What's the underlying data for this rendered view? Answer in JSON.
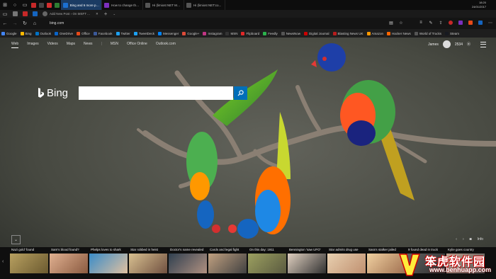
{
  "system": {
    "time": "18:20",
    "date": "24/01/2017"
  },
  "tabs": [
    {
      "title": "Bing and 6 more pa...",
      "active": true,
      "icon_color": "#1b6fd1"
    },
    {
      "title": "How to change the...",
      "active": false,
      "icon_color": "#7b2fbe"
    },
    {
      "title": "Hi (limiost NET Ma...",
      "active": false,
      "icon_color": "#555555"
    },
    {
      "title": "Hi (limiost NET:co...",
      "active": false,
      "icon_color": "#555555"
    }
  ],
  "secondary_tab": {
    "title": "Add New Post ‹ On MSFT ..."
  },
  "address": {
    "url": "bing.com"
  },
  "favorites": [
    "Google",
    "Bing",
    "Outlook",
    "OneDrive",
    "Office",
    "Facebook",
    "Twitter",
    "TweetDeck",
    "Messenger",
    "Google+",
    "Instagram",
    "MSN",
    "Flipboard",
    "Feedly",
    "NewsNow",
    "Digital Journal",
    "Blasting News UK",
    "Amazon",
    "Hacker News",
    "World of Trucks",
    "Steam"
  ],
  "bing": {
    "nav": [
      "Web",
      "Images",
      "Videos",
      "Maps",
      "News",
      "MSN",
      "Office Online",
      "Outlook.com"
    ],
    "user_name": "James",
    "rewards_points": "2534",
    "logo_text": "Bing",
    "search_value": "",
    "info_label": "Info"
  },
  "news": [
    {
      "caption": "Nazi gold' found"
    },
    {
      "caption": "Sam's blood found?"
    },
    {
      "caption": "Phelps loves to shark"
    },
    {
      "caption": "Star robbed in heist"
    },
    {
      "caption": "Doctor's name revealed"
    },
    {
      "caption": "Cards and legal fight"
    },
    {
      "caption": "On this day: 1911"
    },
    {
      "caption": "Bennington 'saw UFO'"
    },
    {
      "caption": "Star admits drug use"
    },
    {
      "caption": "Sara's stalker jailed"
    },
    {
      "caption": "9 found dead in truck"
    },
    {
      "caption": "Kylie goes country"
    }
  ],
  "watermark": {
    "text": "笨虎软件园",
    "url": "www.benhuapp.com"
  },
  "colors": {
    "accent": "#006fb9",
    "active_tab": "#1b3b63"
  }
}
